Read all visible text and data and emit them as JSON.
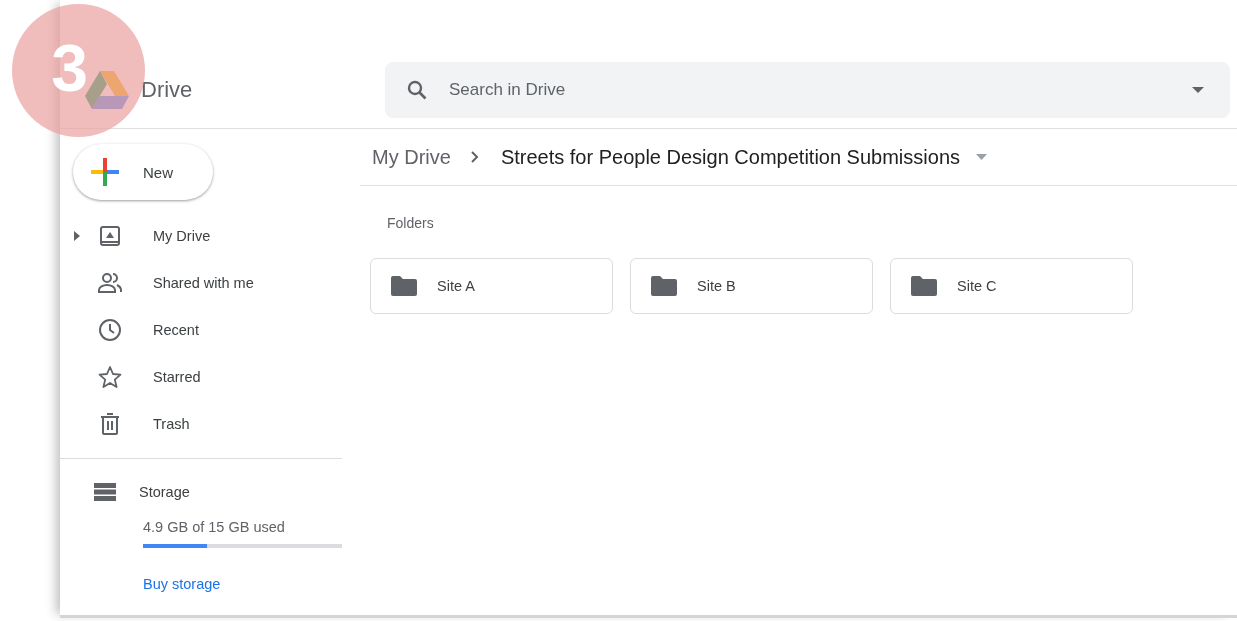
{
  "step_badge": "3",
  "app": {
    "name": "Drive"
  },
  "search": {
    "placeholder": "Search in Drive"
  },
  "new_button": "New",
  "sidebar": {
    "items": [
      {
        "label": "My Drive",
        "expandable": true,
        "selected": false
      },
      {
        "label": "Shared with me",
        "expandable": false,
        "selected": false
      },
      {
        "label": "Recent",
        "expandable": false,
        "selected": false
      },
      {
        "label": "Starred",
        "expandable": false,
        "selected": false
      },
      {
        "label": "Trash",
        "expandable": false,
        "selected": false
      }
    ]
  },
  "storage": {
    "label": "Storage",
    "usage": "4.9 GB of 15 GB used",
    "level": 0.32,
    "link": "Buy storage"
  },
  "breadcrumb": [
    "My Drive",
    "Streets for People Design Competition Submissions"
  ],
  "section_title": "Folders",
  "folders": [
    {
      "name": "Site A"
    },
    {
      "name": "Site B"
    },
    {
      "name": "Site C"
    }
  ]
}
